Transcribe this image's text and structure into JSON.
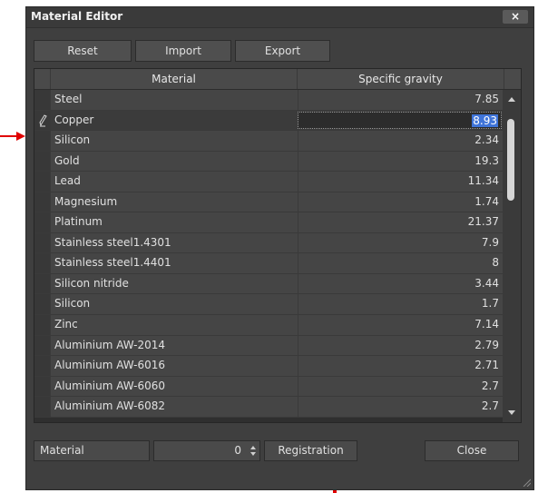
{
  "window": {
    "title": "Material Editor",
    "close_glyph": "×"
  },
  "toolbar": {
    "reset_label": "Reset",
    "import_label": "Import",
    "export_label": "Export"
  },
  "grid": {
    "columns": [
      "Material",
      "Specific gravity"
    ],
    "rows": [
      {
        "material": "Steel",
        "gravity": "7.85"
      },
      {
        "material": "Copper",
        "gravity": "8.93",
        "editing": true
      },
      {
        "material": "Silicon",
        "gravity": "2.34"
      },
      {
        "material": "Gold",
        "gravity": "19.3"
      },
      {
        "material": "Lead",
        "gravity": "11.34"
      },
      {
        "material": "Magnesium",
        "gravity": "1.74"
      },
      {
        "material": "Platinum",
        "gravity": "21.37"
      },
      {
        "material": "Stainless steel1.4301",
        "gravity": "7.9"
      },
      {
        "material": "Stainless steel1.4401",
        "gravity": "8"
      },
      {
        "material": "Silicon nitride",
        "gravity": "3.44"
      },
      {
        "material": "Silicon",
        "gravity": "1.7"
      },
      {
        "material": "Zinc",
        "gravity": "7.14"
      },
      {
        "material": "Aluminium AW-2014",
        "gravity": "2.79"
      },
      {
        "material": "Aluminium AW-6016",
        "gravity": "2.71"
      },
      {
        "material": "Aluminium AW-6060",
        "gravity": "2.7"
      },
      {
        "material": "Aluminium AW-6082",
        "gravity": "2.7"
      }
    ]
  },
  "footer": {
    "material_field": "Material",
    "quantity_value": "0",
    "registration_label": "Registration",
    "close_label": "Close"
  },
  "colors": {
    "window_bg": "#3f3f3f",
    "selection": "#3f74d9",
    "annotation_arrow": "#e00000"
  },
  "icons": [
    "arrow-right-icon",
    "arrow-up-icon",
    "pencil-icon",
    "close-icon",
    "scroll-up-icon",
    "scroll-down-icon",
    "spin-up-icon",
    "spin-down-icon",
    "resize-grip-icon"
  ]
}
